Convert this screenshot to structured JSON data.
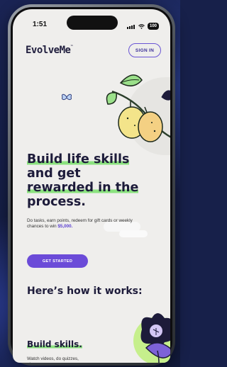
{
  "status_bar": {
    "time": "1:51",
    "battery": "100"
  },
  "header": {
    "logo": "EvolveMe",
    "signin_label": "SIGN IN"
  },
  "hero": {
    "title_line1": "Build life skills",
    "title_line2": "and get",
    "title_line3": "rewarded in the",
    "title_line4": "process.",
    "subtitle": "Do tasks, earn points, redeem for gift cards or weekly chances to win",
    "subtitle_amount": "$5,000.",
    "cta_label": "GET STARTED"
  },
  "how_it_works": {
    "heading": "Here’s how it works:",
    "step1_title": "Build skills.",
    "step1_desc": "Watch videos, do quizzes, play games"
  },
  "colors": {
    "accent_purple": "#6b4bd8",
    "highlight_green": "#8be27f",
    "text_dark": "#1d1b3a",
    "screen_bg": "#efeeec"
  },
  "icons": [
    "signal-icon",
    "wifi-icon",
    "battery-icon",
    "lemon-illustration",
    "butterfly-icon",
    "flower-illustration"
  ]
}
